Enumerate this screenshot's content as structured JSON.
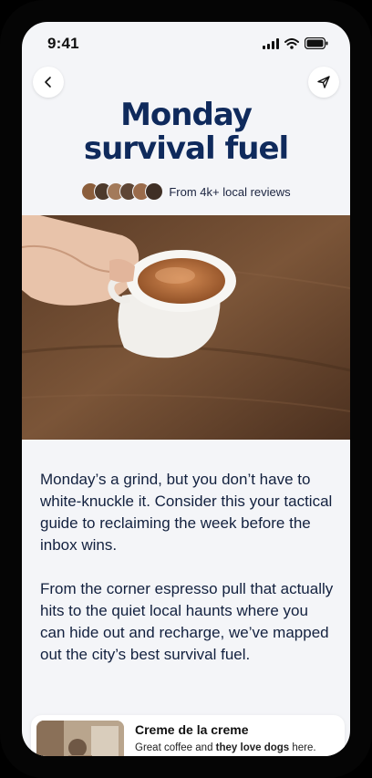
{
  "status_bar": {
    "time": "9:41"
  },
  "header": {
    "title_line1": "Monday",
    "title_line2": "survival fuel",
    "reviews_text": "From 4k+ local reviews"
  },
  "article": {
    "paragraph1": "Monday’s a grind, but you don’t have to white-knuckle it. Consider this your tactical guide to reclaiming the week before the inbox wins.",
    "paragraph2": "From the corner espresso pull that actually hits to the quiet local haunts where you can hide out and recharge, we’ve mapped out the city’s best survival fuel."
  },
  "card": {
    "title": "Creme de la creme",
    "desc_prefix": "Great coffee and ",
    "desc_bold": "they love dogs",
    "desc_suffix": " here."
  },
  "icons": {
    "back": "chevron-left-icon",
    "share": "send-icon",
    "signal": "signal-icon",
    "wifi": "wifi-icon",
    "battery": "battery-icon"
  },
  "colors": {
    "title": "#0f2a5c",
    "background": "#f4f5f8"
  }
}
